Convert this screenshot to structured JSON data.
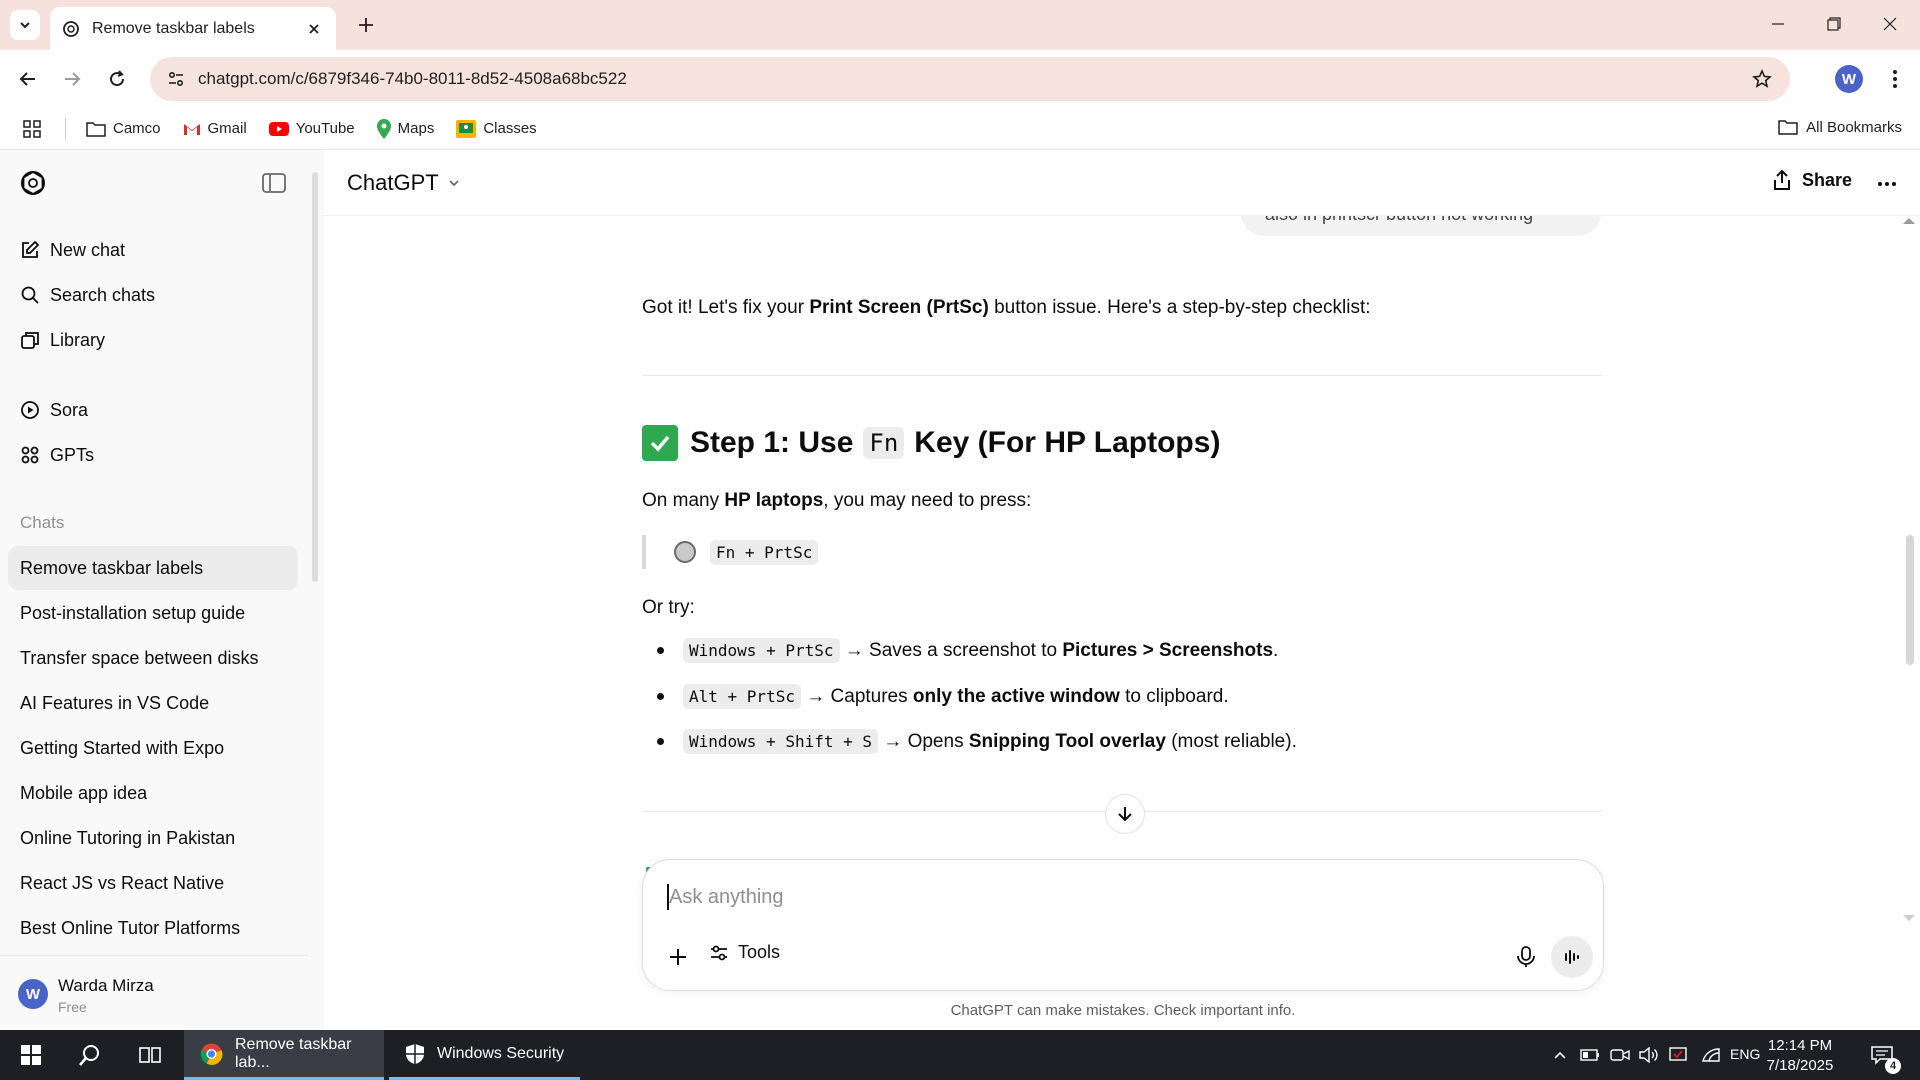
{
  "browser": {
    "tab_title": "Remove taskbar labels",
    "url": "chatgpt.com/c/6879f346-74b0-8011-8d52-4508a68bc522",
    "profile_initial": "W",
    "bookmarks": [
      "Camco",
      "Gmail",
      "YouTube",
      "Maps",
      "Classes"
    ],
    "all_bookmarks": "All Bookmarks"
  },
  "sidebar": {
    "nav": [
      {
        "label": "New chat",
        "icon": "pencil-square-icon"
      },
      {
        "label": "Search chats",
        "icon": "search-icon"
      },
      {
        "label": "Library",
        "icon": "library-icon"
      },
      {
        "label": "Sora",
        "icon": "play-circle-icon"
      },
      {
        "label": "GPTs",
        "icon": "grid-icon"
      }
    ],
    "section_label": "Chats",
    "chats": [
      "Remove taskbar labels",
      "Post-installation setup guide",
      "Transfer space between disks",
      "AI Features in VS Code",
      "Getting Started with Expo",
      "Mobile app idea",
      "Online Tutoring in Pakistan",
      "React JS vs React Native",
      "Best Online Tutor Platforms"
    ],
    "user": {
      "initial": "W",
      "name": "Warda Mirza",
      "plan": "Free"
    }
  },
  "header": {
    "model": "ChatGPT",
    "share_label": "Share"
  },
  "conversation": {
    "user_bubble_fragment": "also in printscr button not working",
    "intro_pre": "Got it! Let's fix your ",
    "intro_bold": "Print Screen (PrtSc)",
    "intro_post": " button issue. Here's a step-by-step checklist:",
    "step_heading_pre": "Step 1: Use",
    "step_heading_key": "Fn",
    "step_heading_post": "Key (For HP Laptops)",
    "press_pre": "On many ",
    "press_bold": "HP laptops",
    "press_post": ", you may need to press:",
    "quote_code": "Fn + PrtSc",
    "or_try": "Or try:",
    "bullets": [
      {
        "code": "Windows + PrtSc",
        "pre": " → Saves a screenshot to ",
        "bold": "Pictures > Screenshots",
        "post": "."
      },
      {
        "code": "Alt + PrtSc",
        "pre": " → Captures ",
        "bold": "only the active window",
        "post": " to clipboard."
      },
      {
        "code": "Windows + Shift + S",
        "pre": " → Opens ",
        "bold": "Snipping Tool overlay",
        "post": " (most reliable)."
      }
    ]
  },
  "composer": {
    "placeholder": "Ask anything",
    "tools_label": "Tools",
    "disclaimer": "ChatGPT can make mistakes. Check important info."
  },
  "taskbar": {
    "apps": [
      {
        "label": "Remove taskbar lab...",
        "icon": "chrome-icon"
      },
      {
        "label": "Windows Security",
        "icon": "shield-icon"
      }
    ],
    "language": "ENG",
    "time": "12:14 PM",
    "date": "7/18/2025",
    "notification_count": "4"
  }
}
